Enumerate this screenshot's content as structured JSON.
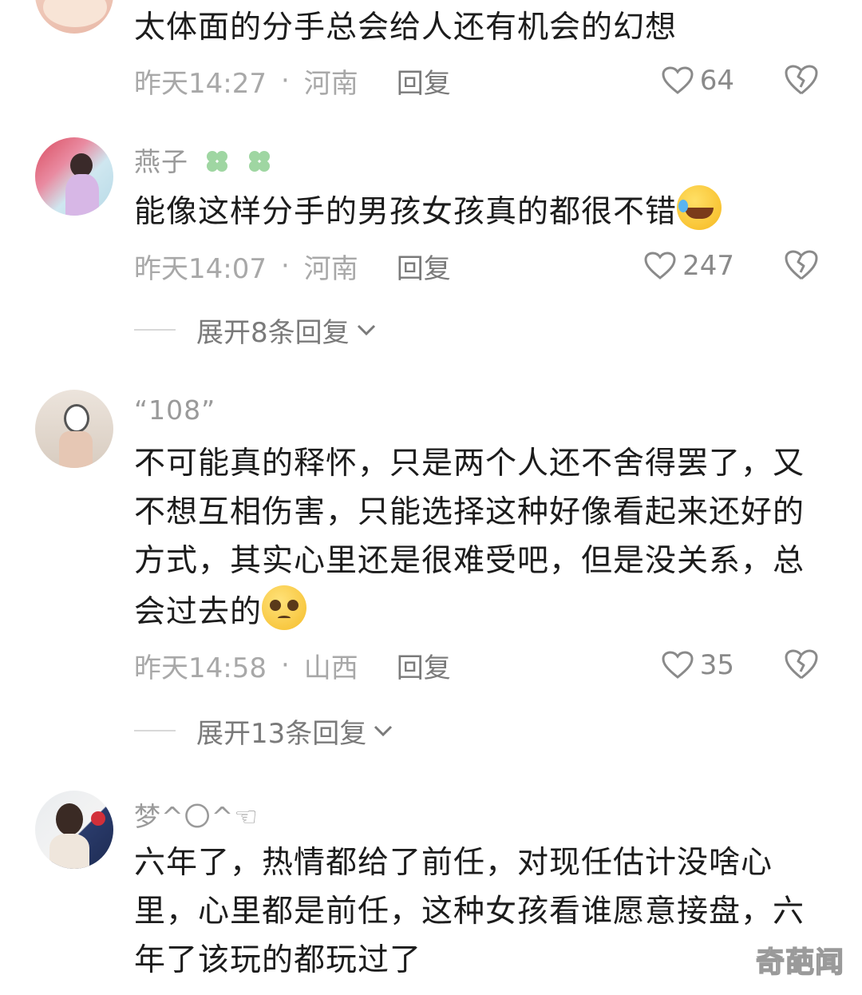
{
  "comments": [
    {
      "username": "",
      "text": "太体面的分手总会给人还有机会的幻想",
      "time": "昨天14:27",
      "location": "河南",
      "reply_label": "回复",
      "likes": "64"
    },
    {
      "username": "燕子",
      "text": "能像这样分手的男孩女孩真的都很不错",
      "time": "昨天14:07",
      "location": "河南",
      "reply_label": "回复",
      "likes": "247",
      "expand_label": "展开8条回复"
    },
    {
      "username": "“108”",
      "text": "不可能真的释怀，只是两个人还不舍得罢了，又不想互相伤害，只能选择这种好像看起来还好的方式，其实心里还是很难受吧，但是没关系，总会过去的",
      "time": "昨天14:58",
      "location": "山西",
      "reply_label": "回复",
      "likes": "35",
      "expand_label": "展开13条回复"
    },
    {
      "username": "梦^〇^☜",
      "text": "六年了，热情都给了前任，对现任估计没啥心里，心里都是前任，这种女孩看谁愿意接盘，六年了该玩的都玩过了"
    }
  ],
  "watermark": "奇葩闻",
  "icons": {
    "like": "heart-outline-icon",
    "dislike": "broken-heart-icon",
    "expand": "chevron-down-icon",
    "laugh_emoji": "rolling-laughing-emoji",
    "pleading_emoji": "pleading-face-emoji",
    "clover": "four-leaf-clover-icon"
  },
  "colors": {
    "primary_text": "#1c1c1c",
    "secondary_text": "#a8a8a8",
    "reply_text": "#7a7a7a"
  }
}
